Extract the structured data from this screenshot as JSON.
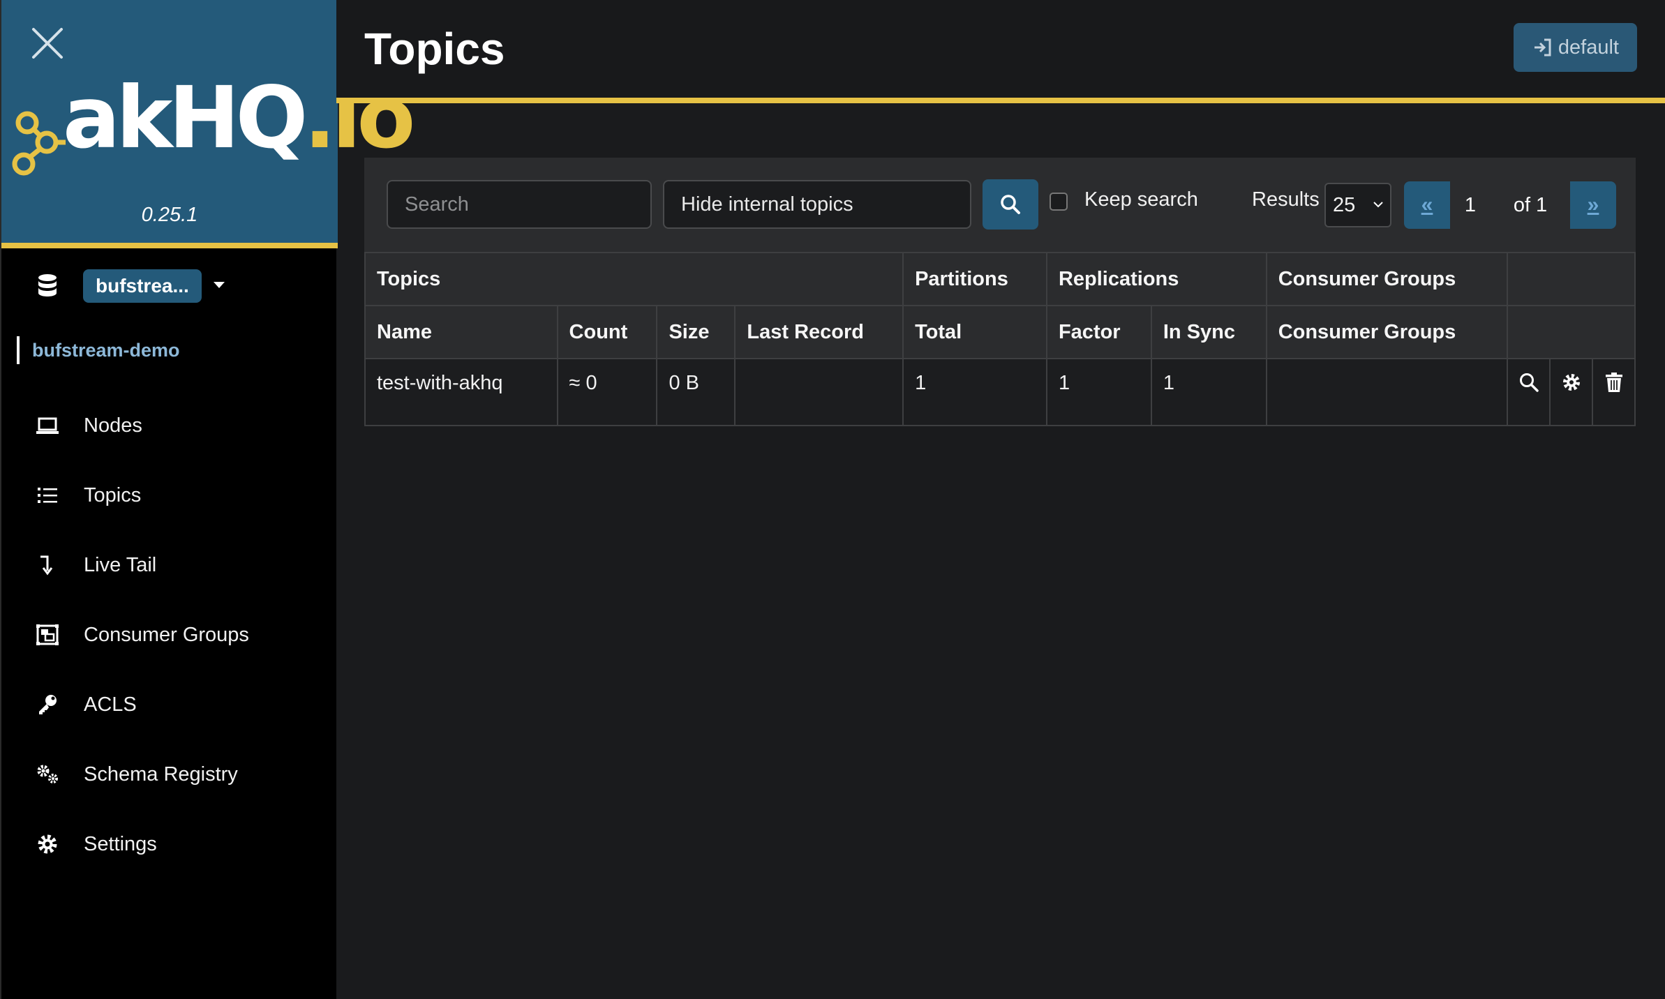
{
  "app": {
    "logo_text": "akhq.io",
    "version": "0.25.1"
  },
  "sidebar": {
    "cluster_selector": "bufstrea...",
    "cluster_name": "bufstream-demo",
    "items": [
      {
        "label": "Nodes",
        "icon": "laptop-icon"
      },
      {
        "label": "Topics",
        "icon": "list-icon"
      },
      {
        "label": "Live Tail",
        "icon": "level-down-icon"
      },
      {
        "label": "Consumer Groups",
        "icon": "object-group-icon"
      },
      {
        "label": "ACLS",
        "icon": "key-icon"
      },
      {
        "label": "Schema Registry",
        "icon": "gears-icon"
      },
      {
        "label": "Settings",
        "icon": "gear-icon"
      }
    ]
  },
  "header": {
    "title": "Topics",
    "login_label": "default"
  },
  "toolbar": {
    "search_placeholder": "Search",
    "filter_value": "Hide internal topics",
    "keep_search_label": "Keep search",
    "results_label": "Results",
    "results_value": "25",
    "pager": {
      "first": "«",
      "current": "1",
      "of": "of 1",
      "last": "»"
    }
  },
  "table": {
    "group_headers": [
      "Topics",
      "Partitions",
      "Replications",
      "Consumer Groups",
      ""
    ],
    "columns": [
      "Name",
      "Count",
      "Size",
      "Last Record",
      "Total",
      "Factor",
      "In Sync",
      "Consumer Groups"
    ],
    "rows": [
      {
        "name": "test-with-akhq",
        "count": "≈ 0",
        "size": "0 B",
        "last_record": "",
        "total": "1",
        "factor": "1",
        "in_sync": "1",
        "consumer_groups": ""
      }
    ]
  },
  "colors": {
    "brand_blue": "#245a7a",
    "accent_yellow": "#e6c245",
    "background": "#1a1b1d",
    "panel": "#2b2c2e"
  }
}
